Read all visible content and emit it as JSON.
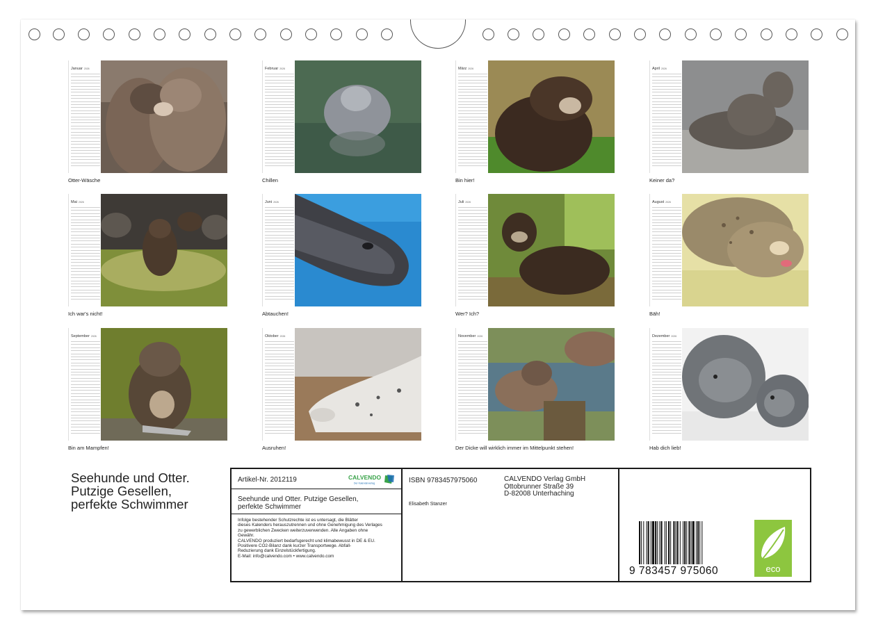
{
  "months": [
    {
      "name": "Januar",
      "year": "2026",
      "caption": "Otter-Wäsche",
      "scene": "otters-grooming"
    },
    {
      "name": "Februar",
      "year": "2026",
      "caption": "Chillen",
      "scene": "seal-water"
    },
    {
      "name": "März",
      "year": "2026",
      "caption": "Bin hier!",
      "scene": "otter-grass"
    },
    {
      "name": "April",
      "year": "2026",
      "caption": "Keiner da?",
      "scene": "seal-beach"
    },
    {
      "name": "Mai",
      "year": "2026",
      "caption": "Ich war's nicht!",
      "scene": "otters-rocks"
    },
    {
      "name": "Juni",
      "year": "2026",
      "caption": "Abtauchen!",
      "scene": "sealion-blue"
    },
    {
      "name": "Juli",
      "year": "2026",
      "caption": "Wer? Ich?",
      "scene": "otter-reeds"
    },
    {
      "name": "August",
      "year": "2026",
      "caption": "Bäh!",
      "scene": "spotted-seal"
    },
    {
      "name": "September",
      "year": "2026",
      "caption": "Bin am Mampfen!",
      "scene": "otter-fish"
    },
    {
      "name": "Oktober",
      "year": "2026",
      "caption": "Ausruhen!",
      "scene": "seal-sand"
    },
    {
      "name": "November",
      "year": "2026",
      "caption": "Der Dicke will wirklich immer im Mittelpunkt stehen!",
      "scene": "otters-log"
    },
    {
      "name": "Dezember",
      "year": "2026",
      "caption": "Hab dich lieb!",
      "scene": "seals-snow"
    }
  ],
  "cover": {
    "title_lines": [
      "Seehunde und Otter.",
      "Putzige Gesellen,",
      "perfekte Schwimmer"
    ]
  },
  "info": {
    "article": "Artikel-Nr. 2012119",
    "logo_text": "CALVENDO",
    "logo_sub": "Der Kalenderverlag",
    "title_line1": "Seehunde und Otter. Putzige Gesellen,",
    "title_line2": "perfekte Schwimmer",
    "legal": [
      "Infolge bestehender Schutzrechte ist es untersagt, die Blätter",
      "dieses Kalenders herauszutrennen und ohne Genehmigung des Verlages",
      "zu gewerblichen Zwecken weiterzuverwenden. Alle Angaben ohne",
      "Gewähr.",
      "CALVENDO produziert bedarfsgerecht und klimabewusst in DE & EU.",
      "Positivere CO2-Bilanz dank kurzer Transportwege. Abfall-",
      "Reduzierung dank Einzelstückfertigung.",
      "E-Mail: info@calvendo.com • www.calvendo.com"
    ],
    "isbn": "ISBN 9783457975060",
    "author": "Elisabeth Stanzer",
    "publisher": [
      "CALVENDO Verlag GmbH",
      "Ottobrunner Straße 39",
      "D-82008 Unterhaching"
    ],
    "barcode_digits": "9 783457 975060",
    "eco_label": "eco"
  },
  "colors": {
    "eco_green": "#8dc63f",
    "logo_green": "#3aa34a",
    "logo_blue": "#1d6fb5"
  }
}
